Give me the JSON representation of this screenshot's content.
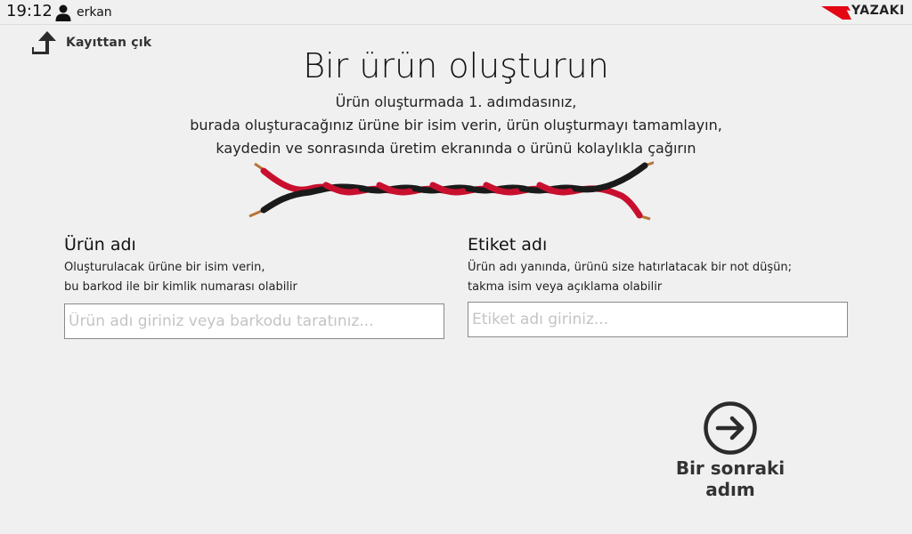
{
  "topbar": {
    "time": "19:12",
    "username": "erkan",
    "brand": "YAZAKI",
    "brand_color": "#e30613"
  },
  "logout": {
    "label": "Kayıttan çık",
    "icon": "logout-arrow-icon"
  },
  "heading": {
    "title": "Bir ürün oluşturun",
    "lines": [
      "Ürün oluşturmada 1. adımdasınız,",
      "burada oluşturacağınız ürüne bir isim verin, ürün oluşturmayı tamamlayın,",
      "kaydedin ve sonrasında üretim ekranında o ürünü kolaylıkla çağırın"
    ]
  },
  "product_field": {
    "label": "Ürün adı",
    "desc_lines": [
      "Oluşturulacak ürüne bir isim verin,",
      "bu barkod ile bir kimlik numarası olabilir"
    ],
    "value": "",
    "placeholder": "Ürün adı giriniz veya barkodu taratınız..."
  },
  "label_field": {
    "label": "Etiket adı",
    "desc_lines": [
      "Ürün adı yanında, ürünü size hatırlatacak bir not düşün;",
      "takma isim veya açıklama olabilir"
    ],
    "value": "",
    "placeholder": "Etiket adı giriniz..."
  },
  "next_step": {
    "label": "Bir sonraki adım",
    "icon": "arrow-right-circle-icon"
  },
  "colors": {
    "background": "#f0f0f0",
    "wire_red": "#c8102e",
    "wire_black": "#1a1a1a",
    "copper": "#b8733a"
  }
}
